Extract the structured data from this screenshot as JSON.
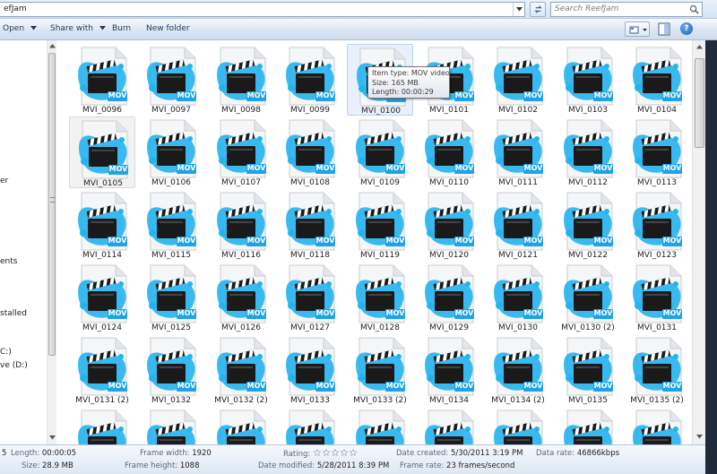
{
  "address": {
    "path": "efJam"
  },
  "search": {
    "placeholder": "Search ReefJam"
  },
  "toolbar": {
    "open_label": "Open",
    "share_label": "Share with",
    "burn_label": "Burn",
    "new_folder_label": "New folder",
    "help_label": "?"
  },
  "nav": {
    "items": [
      {
        "label": "er"
      },
      {
        "label": "ents"
      },
      {
        "label": "stalled"
      },
      {
        "label": "C:)"
      },
      {
        "label": "ve (D:)"
      }
    ]
  },
  "files": {
    "badge": "MOV",
    "rows": [
      [
        "MVI_0096",
        "MVI_0097",
        "MVI_0098",
        "MVI_0099",
        "MVI_0100",
        "MVI_0101",
        "MVI_0102",
        "MVI_0103",
        "MVI_0104"
      ],
      [
        "MVI_0105",
        "MVI_0106",
        "MVI_0107",
        "MVI_0108",
        "MVI_0109",
        "MVI_0110",
        "MVI_0111",
        "MVI_0112",
        "MVI_0113"
      ],
      [
        "MVI_0114",
        "MVI_0115",
        "MVI_0116",
        "MVI_0118",
        "MVI_0119",
        "MVI_0120",
        "MVI_0121",
        "MVI_0122",
        "MVI_0123"
      ],
      [
        "MVI_0124",
        "MVI_0125",
        "MVI_0126",
        "MVI_0127",
        "MVI_0128",
        "MVI_0129",
        "MVI_0130",
        "MVI_0130 (2)",
        "MVI_0131"
      ],
      [
        "MVI_0131 (2)",
        "MVI_0132",
        "MVI_0132 (2)",
        "MVI_0133",
        "MVI_0133 (2)",
        "MVI_0134",
        "MVI_0134 (2)",
        "MVI_0135",
        "MVI_0135 (2)"
      ],
      [
        "",
        "",
        "",
        "",
        "",
        "",
        "",
        "",
        ""
      ]
    ],
    "selected": "MVI_0105",
    "hovered": "MVI_0100"
  },
  "tooltip": {
    "type": "Item type: MOV video",
    "size": "Size: 165 MB",
    "length": "Length: 00:00:29"
  },
  "details": {
    "count_fragment": "5",
    "length_label": "Length:",
    "length_value": "00:00:05",
    "size_label": "Size:",
    "size_value": "28.9 MB",
    "frame_width_label": "Frame width:",
    "frame_width_value": "1920",
    "frame_height_label": "Frame height:",
    "frame_height_value": "1088",
    "rating_label": "Rating:",
    "rating_stars": 0,
    "date_modified_label": "Date modified:",
    "date_modified_value": "5/28/2011 8:39 PM",
    "date_created_label": "Date created:",
    "date_created_value": "5/30/2011 3:19 PM",
    "frame_rate_label": "Frame rate:",
    "frame_rate_value": "23 frames/second",
    "data_rate_label": "Data rate:",
    "data_rate_value": "46866kbps"
  },
  "colors": {
    "badge": "#1fa3e6",
    "splash": "#23b4f0",
    "clapper": "#1a1a1a",
    "tooltip_border": "#767676"
  }
}
